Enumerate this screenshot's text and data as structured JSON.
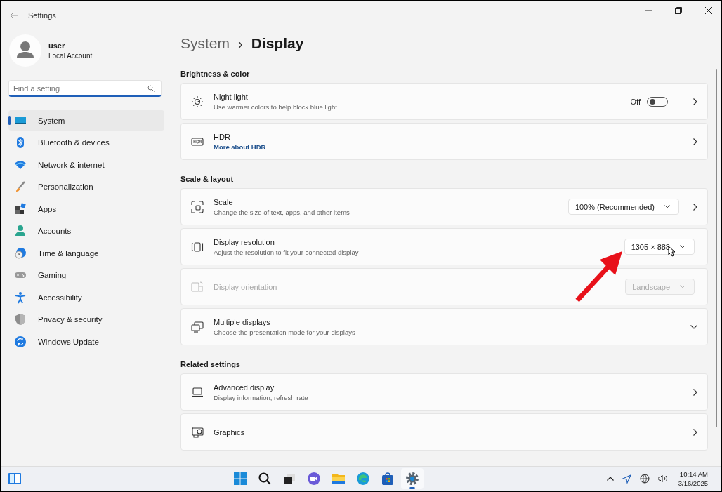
{
  "window": {
    "title": "Settings"
  },
  "account": {
    "name": "user",
    "type": "Local Account"
  },
  "search": {
    "placeholder": "Find a setting"
  },
  "nav": [
    {
      "label": "System",
      "selected": true
    },
    {
      "label": "Bluetooth & devices",
      "selected": false
    },
    {
      "label": "Network & internet",
      "selected": false
    },
    {
      "label": "Personalization",
      "selected": false
    },
    {
      "label": "Apps",
      "selected": false
    },
    {
      "label": "Accounts",
      "selected": false
    },
    {
      "label": "Time & language",
      "selected": false
    },
    {
      "label": "Gaming",
      "selected": false
    },
    {
      "label": "Accessibility",
      "selected": false
    },
    {
      "label": "Privacy & security",
      "selected": false
    },
    {
      "label": "Windows Update",
      "selected": false
    }
  ],
  "breadcrumb": {
    "parent": "System",
    "separator": "›",
    "current": "Display"
  },
  "sections": [
    {
      "heading": "Brightness & color",
      "cards": [
        {
          "title": "Night light",
          "description": "Use warmer colors to help block blue light",
          "toggle": {
            "label": "Off",
            "on": false
          },
          "kind": "navigate",
          "disabled": false
        },
        {
          "title": "HDR",
          "link": "More about HDR",
          "kind": "navigate",
          "disabled": false
        }
      ]
    },
    {
      "heading": "Scale & layout",
      "cards": [
        {
          "title": "Scale",
          "description": "Change the size of text, apps, and other items",
          "dropdown": "100% (Recommended)",
          "kind": "navigate",
          "disabled": false
        },
        {
          "title": "Display resolution",
          "description": "Adjust the resolution to fit your connected display",
          "dropdown": "1305 × 888",
          "kind": "inline",
          "disabled": false
        },
        {
          "title": "Display orientation",
          "dropdown": "Landscape",
          "kind": "inline",
          "disabled": true
        },
        {
          "title": "Multiple displays",
          "description": "Choose the presentation mode for your displays",
          "kind": "expand",
          "disabled": false
        }
      ]
    },
    {
      "heading": "Related settings",
      "cards": [
        {
          "title": "Advanced display",
          "description": "Display information, refresh rate",
          "kind": "navigate",
          "disabled": false
        },
        {
          "title": "Graphics",
          "kind": "navigate",
          "disabled": false
        }
      ]
    }
  ],
  "taskbar": {
    "apps": [
      {
        "selected": false
      },
      {
        "selected": false
      },
      {
        "selected": false
      },
      {
        "selected": false
      },
      {
        "selected": false
      },
      {
        "selected": false
      },
      {
        "selected": false
      },
      {
        "selected": true
      }
    ],
    "time": "10:14 AM",
    "date": "3/16/2025"
  }
}
